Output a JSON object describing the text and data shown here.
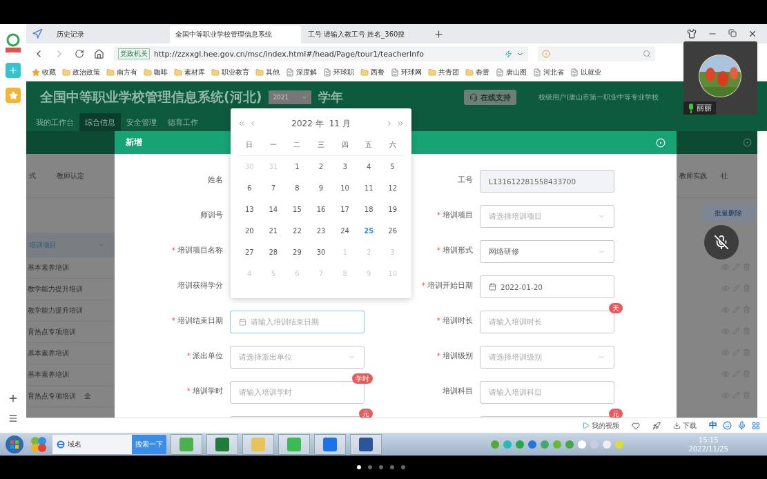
{
  "browser": {
    "tabs": [
      {
        "label": "历史记录",
        "selected": false
      },
      {
        "label": "全国中等职业学校管理信息系统",
        "selected": true
      },
      {
        "label": "工号 请输入教工号 姓名_360搜",
        "selected": false
      }
    ],
    "address": {
      "badge": "党政机关",
      "url": "http://zzxxgl.hee.gov.cn/msc/index.html#/head/Page/tour1/teacherInfo"
    },
    "bookmarks": [
      {
        "label": "收藏",
        "kind": "star"
      },
      {
        "label": "政治政策",
        "kind": "folder"
      },
      {
        "label": "南方有",
        "kind": "folder"
      },
      {
        "label": "咖啡",
        "kind": "folder"
      },
      {
        "label": "素材库",
        "kind": "folder"
      },
      {
        "label": "职业教育",
        "kind": "folder"
      },
      {
        "label": "其他",
        "kind": "folder"
      },
      {
        "label": "深度解",
        "kind": "page"
      },
      {
        "label": "环球职",
        "kind": "page"
      },
      {
        "label": "西餐",
        "kind": "folder"
      },
      {
        "label": "环球网",
        "kind": "page"
      },
      {
        "label": "共青团",
        "kind": "folder"
      },
      {
        "label": "春蕾",
        "kind": "folder"
      },
      {
        "label": "唐山图",
        "kind": "page"
      },
      {
        "label": "河北省",
        "kind": "page"
      },
      {
        "label": "以就业",
        "kind": "page"
      }
    ],
    "status_bar": {
      "video": "我的视频",
      "download": "下载",
      "ime": "中"
    }
  },
  "site": {
    "title": "全国中等职业学校管理信息系统(河北)",
    "year": "2021",
    "year_suffix": "学年",
    "support": "在线支持",
    "user": "校级用户(唐山市第一职业中等专业学校",
    "nav": [
      {
        "label": "我的工作台",
        "selected": false
      },
      {
        "label": "综合信息",
        "selected": true
      },
      {
        "label": "安全管理",
        "selected": false
      },
      {
        "label": "德育工作",
        "selected": false
      }
    ]
  },
  "background": {
    "left_tabs": [
      "式",
      "教师认定"
    ],
    "column_header": "培训项目",
    "left_rows": [
      {
        "text": "基本素养培训"
      },
      {
        "text": "教学能力提升培训"
      },
      {
        "text": "教学能力提升培训"
      },
      {
        "text": "育热点专项培训"
      },
      {
        "text": "基本素养培训"
      },
      {
        "text": "基本素养培训"
      },
      {
        "text": "育热点专项培训",
        "extra": "全"
      }
    ],
    "right_tabs": [
      "教师实践",
      "社"
    ],
    "batch_button": "批量删除"
  },
  "dialog": {
    "title": "新增",
    "fields": [
      {
        "label": "姓名"
      },
      {
        "label": "工号",
        "control": {
          "kind": "readonly",
          "value": "L131612281558433700",
          "focused": false
        }
      },
      {
        "label": "师训号"
      },
      {
        "label": "培训项目",
        "marker": "*",
        "control": {
          "kind": "select",
          "placeholder": "请选择培训项目",
          "focused": false
        }
      },
      {
        "label": "培训项目名称",
        "marker": "*"
      },
      {
        "label": "培训形式",
        "marker": "*",
        "control": {
          "kind": "select",
          "value": "网络研修",
          "focused": false
        }
      },
      {
        "label": "培训获得学分"
      },
      {
        "label": "培训开始日期",
        "marker": "*",
        "control": {
          "kind": "date",
          "value": "2022-01-20",
          "focused": false
        }
      },
      {
        "label": "培训结束日期",
        "marker": "*",
        "control": {
          "kind": "date",
          "placeholder": "请输入培训结束日期",
          "focused": true
        }
      },
      {
        "label": "培训时长",
        "marker": "*",
        "control": {
          "kind": "text",
          "placeholder": "请输入培训时长",
          "badge": "天",
          "focused": false
        }
      },
      {
        "label": "派出单位",
        "marker": "*",
        "control": {
          "kind": "select",
          "placeholder": "请选择派出单位",
          "focused": false
        }
      },
      {
        "label": "培训级别",
        "marker": "*",
        "control": {
          "kind": "select",
          "placeholder": "请选择培训级别",
          "focused": false
        }
      },
      {
        "label": "培训学时",
        "marker": "*",
        "control": {
          "kind": "text",
          "placeholder": "请输入培训学时",
          "badge": "学时",
          "focused": false
        }
      },
      {
        "label": "培训科目",
        "control": {
          "kind": "text",
          "placeholder": "请输入培训科目",
          "focused": false
        }
      },
      {
        "control": {
          "kind": "text",
          "badge": "元",
          "focused": false
        }
      },
      {
        "control": {
          "kind": "text",
          "badge": "元",
          "focused": false
        }
      }
    ]
  },
  "date_picker": {
    "year": "2022 年",
    "month": "11 月",
    "weekdays": [
      "日",
      "一",
      "二",
      "三",
      "四",
      "五",
      "六"
    ],
    "weeks": [
      [
        {
          "label": "30",
          "muted": true,
          "today": false
        },
        {
          "label": "31",
          "muted": true,
          "today": false
        },
        {
          "label": "1",
          "muted": false,
          "today": false
        },
        {
          "label": "2",
          "muted": false,
          "today": false
        },
        {
          "label": "3",
          "muted": false,
          "today": false
        },
        {
          "label": "4",
          "muted": false,
          "today": false
        },
        {
          "label": "5",
          "muted": false,
          "today": false
        }
      ],
      [
        {
          "label": "6",
          "muted": false,
          "today": false
        },
        {
          "label": "7",
          "muted": false,
          "today": false
        },
        {
          "label": "8",
          "muted": false,
          "today": false
        },
        {
          "label": "9",
          "muted": false,
          "today": false
        },
        {
          "label": "10",
          "muted": false,
          "today": false
        },
        {
          "label": "11",
          "muted": false,
          "today": false
        },
        {
          "label": "12",
          "muted": false,
          "today": false
        }
      ],
      [
        {
          "label": "13",
          "muted": false,
          "today": false
        },
        {
          "label": "14",
          "muted": false,
          "today": false
        },
        {
          "label": "15",
          "muted": false,
          "today": false
        },
        {
          "label": "16",
          "muted": false,
          "today": false
        },
        {
          "label": "17",
          "muted": false,
          "today": false
        },
        {
          "label": "18",
          "muted": false,
          "today": false
        },
        {
          "label": "19",
          "muted": false,
          "today": false
        }
      ],
      [
        {
          "label": "20",
          "muted": false,
          "today": false
        },
        {
          "label": "21",
          "muted": false,
          "today": false
        },
        {
          "label": "22",
          "muted": false,
          "today": false
        },
        {
          "label": "23",
          "muted": false,
          "today": false
        },
        {
          "label": "24",
          "muted": false,
          "today": false
        },
        {
          "label": "25",
          "muted": false,
          "today": true
        },
        {
          "label": "26",
          "muted": false,
          "today": false
        }
      ],
      [
        {
          "label": "27",
          "muted": false,
          "today": false
        },
        {
          "label": "28",
          "muted": false,
          "today": false
        },
        {
          "label": "29",
          "muted": false,
          "today": false
        },
        {
          "label": "30",
          "muted": false,
          "today": false
        },
        {
          "label": "1",
          "muted": true,
          "today": false
        },
        {
          "label": "2",
          "muted": true,
          "today": false
        },
        {
          "label": "3",
          "muted": true,
          "today": false
        }
      ],
      [
        {
          "label": "4",
          "muted": true,
          "today": false
        },
        {
          "label": "5",
          "muted": true,
          "today": false
        },
        {
          "label": "6",
          "muted": true,
          "today": false
        },
        {
          "label": "7",
          "muted": true,
          "today": false
        },
        {
          "label": "8",
          "muted": true,
          "today": false
        },
        {
          "label": "9",
          "muted": true,
          "today": false
        },
        {
          "label": "10",
          "muted": true,
          "today": false
        }
      ]
    ]
  },
  "video_call": {
    "name": "丽丽",
    "muted": true
  },
  "taskbar": {
    "search_placeholder": "域名",
    "search_button": "搜索一下",
    "time": "15:15",
    "date": "2022/11/25"
  }
}
